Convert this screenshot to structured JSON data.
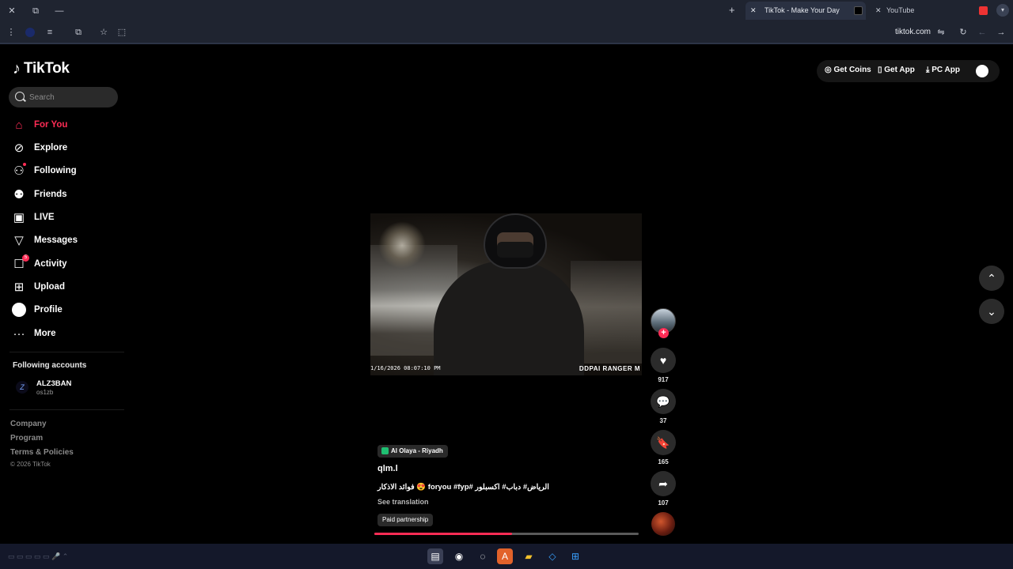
{
  "browser": {
    "tabs": [
      {
        "title": "TikTok - Make Your Day",
        "active": true
      },
      {
        "title": "YouTube",
        "active": false
      }
    ],
    "url": "tiktok.com",
    "window_close": "✕",
    "window_restore": "⧉",
    "window_minimize": "—",
    "new_tab": "+"
  },
  "sidebar": {
    "logo": "TikTok",
    "search_placeholder": "Search",
    "nav": [
      {
        "label": "For You",
        "icon": "home-icon",
        "active": true
      },
      {
        "label": "Explore",
        "icon": "compass-icon"
      },
      {
        "label": "Following",
        "icon": "following-icon"
      },
      {
        "label": "Friends",
        "icon": "friends-icon"
      },
      {
        "label": "LIVE",
        "icon": "live-icon"
      },
      {
        "label": "Messages",
        "icon": "messages-icon"
      },
      {
        "label": "Activity",
        "icon": "activity-icon",
        "badge": "5"
      },
      {
        "label": "Upload",
        "icon": "upload-icon"
      },
      {
        "label": "Profile",
        "icon": "profile-icon"
      },
      {
        "label": "More",
        "icon": "more-icon"
      }
    ],
    "following_title": "Following accounts",
    "following_accounts": [
      {
        "name": "ALZ3BAN",
        "handle": "os1zb"
      }
    ],
    "footer": [
      "Company",
      "Program",
      "Terms & Policies"
    ],
    "copyright": "© 2026 TikTok"
  },
  "topbar": {
    "get_coins": "Get Coins",
    "get_app": "Get App",
    "pc_app": "PC App"
  },
  "video": {
    "timestamp": "1/16/2026 08:07:10 PM",
    "brand": "DDPAI RANGER M",
    "location": "Al Olaya - Riyadh",
    "username": "qlm.l",
    "caption": "الرياض# دباب# اكسبلور #foryou #fyp 😍 فوائد الاذكار",
    "see_translation": "See translation",
    "paid_partnership": "Paid partnership",
    "progress": 0.52,
    "stats": {
      "likes": "917",
      "comments": "37",
      "saves": "165",
      "shares": "107"
    }
  },
  "colors": {
    "accent": "#fe2c55",
    "background": "#000000",
    "chrome": "#1f2430"
  }
}
